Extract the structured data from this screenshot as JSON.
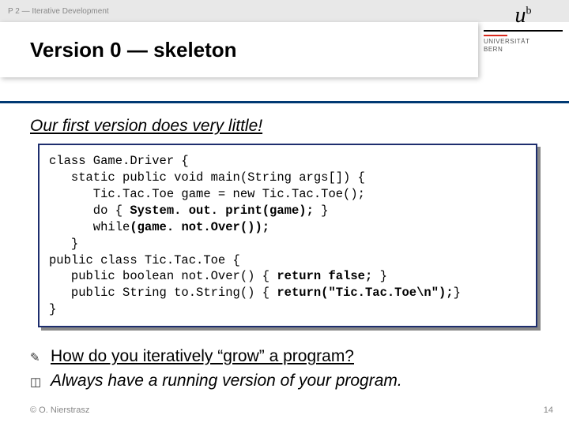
{
  "header": {
    "breadcrumb": "P 2 — Iterative Development"
  },
  "title": "Version 0 — skeleton",
  "logo": {
    "u": "u",
    "b": "b",
    "line1": "UNIVERSITÄT",
    "line2": "BERN"
  },
  "subtitle": "Our first version does very little!",
  "code": {
    "l1": "class Game.Driver {",
    "l2": "   static public void main(String args[]) {",
    "l3": "      Tic.Tac.Toe game = new Tic.Tac.Toe();",
    "l4a": "      do { ",
    "l4b": "System. out. print(game); ",
    "l4c": "}",
    "l5a": "      while",
    "l5b": "(game. not.Over());",
    "l6": "   }",
    "l7": "public class Tic.Tac.Toe {",
    "l8a": "   public boolean not.Over() { ",
    "l8b": "return false; ",
    "l8c": "}",
    "l9a": "   public String to.String() { ",
    "l9b": "return(\"Tic.Tac.Toe\\n\");",
    "l9c": "}",
    "l10": "}"
  },
  "question": "How do you iteratively “grow” a program?",
  "answer": "Always have a running version of your program.",
  "footer": {
    "copyright": "© O. Nierstrasz",
    "page": "14"
  }
}
